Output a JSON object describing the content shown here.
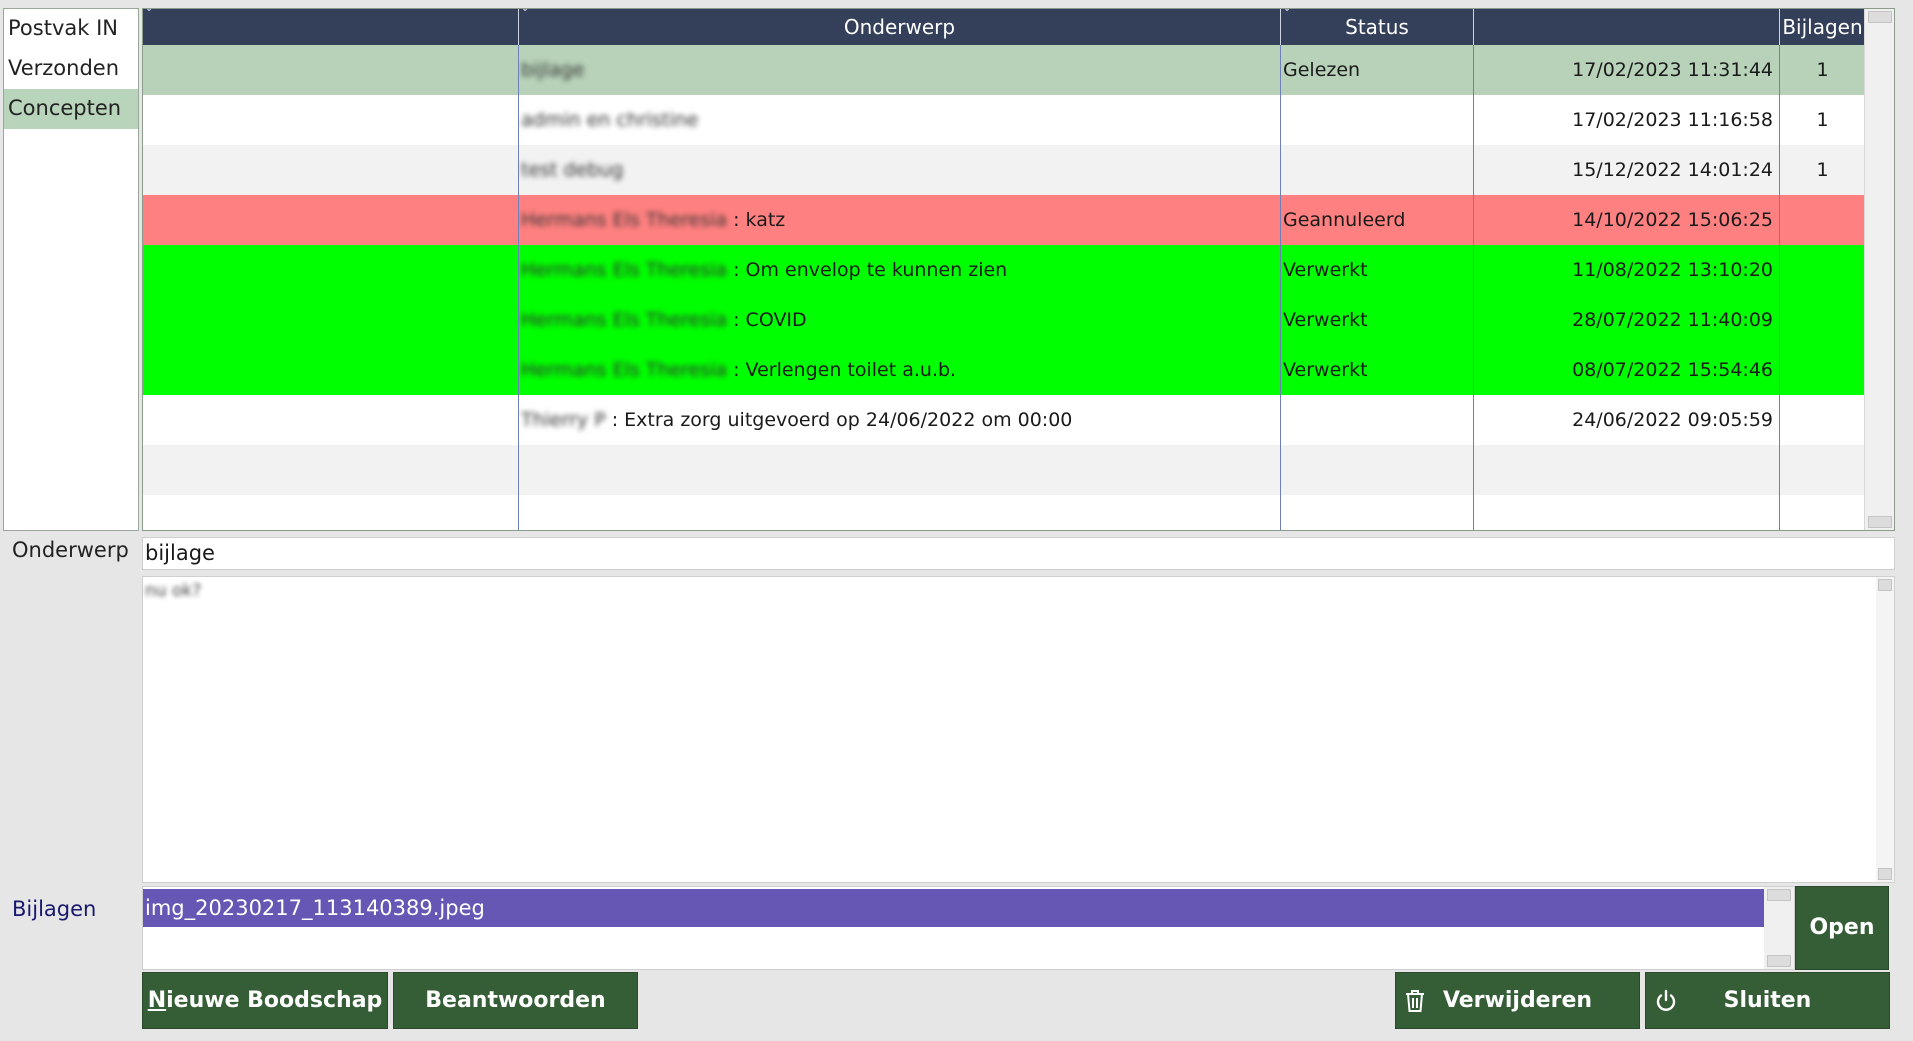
{
  "folders": {
    "items": [
      {
        "label": "Postvak IN"
      },
      {
        "label": "Verzonden"
      },
      {
        "label": "Concepten"
      }
    ],
    "active_index": 2
  },
  "grid": {
    "columns": [
      "",
      "Onderwerp",
      "Status",
      "",
      "Bijlagen"
    ],
    "rows": [
      {
        "sender": "",
        "subject": "bijlage",
        "status": "Gelezen",
        "date": "17/02/2023 11:31:44",
        "attachments": "1",
        "style": "read"
      },
      {
        "sender": "",
        "subject": "admin en christine",
        "status": "",
        "date": "17/02/2023 11:16:58",
        "attachments": "1",
        "style": "white"
      },
      {
        "sender": "",
        "subject": "test debug",
        "status": "",
        "date": "15/12/2022 14:01:24",
        "attachments": "1",
        "style": "alt"
      },
      {
        "sender": "Hermans Els Theresia",
        "subject": ": katz",
        "status": "Geannuleerd",
        "date": "14/10/2022 15:06:25",
        "attachments": "",
        "style": "cancel"
      },
      {
        "sender": "Hermans Els Theresia",
        "subject": ": Om envelop te kunnen zien",
        "status": "Verwerkt",
        "date": "11/08/2022 13:10:20",
        "attachments": "",
        "style": "done"
      },
      {
        "sender": "Hermans Els Theresia",
        "subject": ": COVID",
        "status": "Verwerkt",
        "date": "28/07/2022 11:40:09",
        "attachments": "",
        "style": "done"
      },
      {
        "sender": "Hermans Els Theresia",
        "subject": ": Verlengen toilet a.u.b.",
        "status": "Verwerkt",
        "date": "08/07/2022 15:54:46",
        "attachments": "",
        "style": "done"
      },
      {
        "sender": "Thierry P",
        "subject": ": Extra zorg uitgevoerd op 24/06/2022 om 00:00",
        "status": "",
        "date": "24/06/2022 09:05:59",
        "attachments": "",
        "style": "white"
      },
      {
        "sender": "",
        "subject": "",
        "status": "",
        "date": "",
        "attachments": "",
        "style": "alt"
      },
      {
        "sender": "",
        "subject": "",
        "status": "",
        "date": "",
        "attachments": "",
        "style": "white"
      }
    ]
  },
  "detail": {
    "subject_label": "Onderwerp",
    "subject_value": "bijlage",
    "body_text": "nu ok?",
    "attachments_label": "Bijlagen",
    "attachment_file": "img_20230217_113140389.jpeg",
    "open_label": "Open"
  },
  "buttons": {
    "new_first": "N",
    "new_rest": "ieuwe Boodschap",
    "reply": "Beantwoorden",
    "delete": "Verwijderen",
    "close": "Sluiten"
  },
  "icons": {
    "delete": "trash-icon",
    "close": "power-icon",
    "sort": "sort-icon"
  },
  "colors": {
    "header": "#34405a",
    "read": "#b7d2b9",
    "cancelled": "#ff8080",
    "processed": "#00ff00",
    "button": "#355d36",
    "selection": "#6657b4"
  }
}
